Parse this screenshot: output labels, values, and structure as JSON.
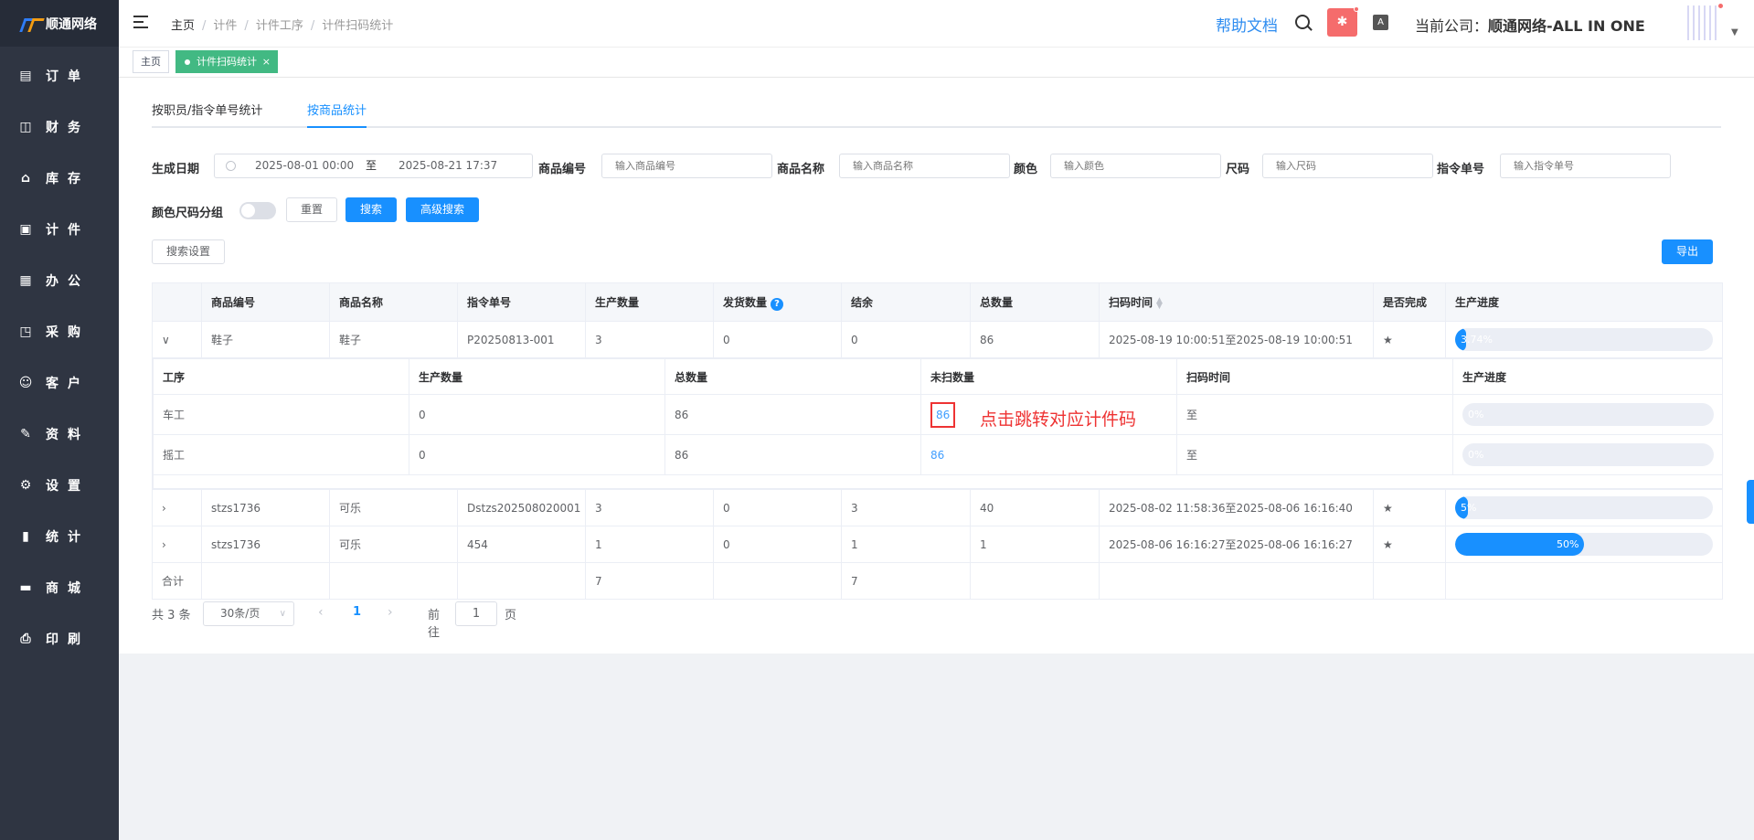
{
  "brand": {
    "name": "顺通网络"
  },
  "sidebar": {
    "items": [
      {
        "label": "订单",
        "icon": "order-icon",
        "glyph": "▤"
      },
      {
        "label": "财务",
        "icon": "finance-icon",
        "glyph": "◫"
      },
      {
        "label": "库存",
        "icon": "warehouse-icon",
        "glyph": "⌂"
      },
      {
        "label": "计件",
        "icon": "clipboard-icon",
        "glyph": "▣"
      },
      {
        "label": "办公",
        "icon": "calendar-icon",
        "glyph": "▦"
      },
      {
        "label": "采购",
        "icon": "bag-icon",
        "glyph": "◳"
      },
      {
        "label": "客户",
        "icon": "user-icon",
        "glyph": "☺"
      },
      {
        "label": "资料",
        "icon": "edit-icon",
        "glyph": "✎"
      },
      {
        "label": "设置",
        "icon": "gear-icon",
        "glyph": "⚙"
      },
      {
        "label": "统计",
        "icon": "bar-chart-icon",
        "glyph": "▮"
      },
      {
        "label": "商城",
        "icon": "shop-icon",
        "glyph": "▬"
      },
      {
        "label": "印刷",
        "icon": "printer-icon",
        "glyph": "⎙"
      }
    ]
  },
  "header": {
    "breadcrumb": [
      "主页",
      "计件",
      "计件工序",
      "计件扫码统计"
    ],
    "help": "帮助文档",
    "company_label": "当前公司：",
    "company_name": "顺通网络-ALL IN ONE",
    "translate_glyph": "A",
    "bug_glyph": "✱"
  },
  "tags": {
    "home": "主页",
    "active": "计件扫码统计",
    "close": "×"
  },
  "tabs": [
    "按职员/指令单号统计",
    "按商品统计"
  ],
  "filters": {
    "date_label": "生成日期",
    "date_start": "2025-08-01 00:00",
    "date_to": "至",
    "date_end": "2025-08-21 17:37",
    "product_code_label": "商品编号",
    "product_code_placeholder": "输入商品编号",
    "product_name_label": "商品名称",
    "product_name_placeholder": "输入商品名称",
    "color_label": "颜色",
    "color_placeholder": "输入颜色",
    "size_label": "尺码",
    "size_placeholder": "输入尺码",
    "order_label": "指令单号",
    "order_placeholder": "输入指令单号",
    "group_label": "颜色尺码分组",
    "group_on": false,
    "reset": "重置",
    "search": "搜索",
    "advanced": "高级搜索",
    "search_settings": "搜索设置",
    "export": "导出"
  },
  "table": {
    "headers": [
      "商品编号",
      "商品名称",
      "指令单号",
      "生产数量",
      "发货数量",
      "结余",
      "总数量",
      "扫码时间",
      "是否完成",
      "生产进度"
    ],
    "help_glyph": "?",
    "rows": [
      {
        "expanded": true,
        "code": "鞋子",
        "name": "鞋子",
        "order": "P20250813-001",
        "produced": "3",
        "shipped": "0",
        "balance": "0",
        "total": "86",
        "scan_time": "2025-08-19 10:00:51至2025-08-19 10:00:51",
        "done": true,
        "progress": 3.74,
        "progress_label": "3.74%"
      },
      {
        "expanded": false,
        "code": "stzs1736",
        "name": "可乐",
        "order": "Dstzs202508020001",
        "produced": "3",
        "shipped": "0",
        "balance": "3",
        "total": "40",
        "scan_time": "2025-08-02 11:58:36至2025-08-06 16:16:40",
        "done": true,
        "progress": 5,
        "progress_label": "5%"
      },
      {
        "expanded": false,
        "code": "stzs1736",
        "name": "可乐",
        "order": "454",
        "produced": "1",
        "shipped": "0",
        "balance": "1",
        "total": "1",
        "scan_time": "2025-08-06 16:16:27至2025-08-06 16:16:27",
        "done": true,
        "progress": 50,
        "progress_label": "50%"
      }
    ],
    "sub": {
      "headers": [
        "工序",
        "生产数量",
        "总数量",
        "未扫数量",
        "扫码时间",
        "生产进度"
      ],
      "rows": [
        {
          "process": "车工",
          "produced": "0",
          "total": "86",
          "unscanned": "86",
          "scan_time": "至",
          "progress": 0,
          "progress_label": "0%"
        },
        {
          "process": "摇工",
          "produced": "0",
          "total": "86",
          "unscanned": "86",
          "scan_time": "至",
          "progress": 0,
          "progress_label": "0%"
        }
      ]
    },
    "summary": {
      "label": "合计",
      "produced": "7",
      "balance": "7"
    }
  },
  "annotation": "点击跳转对应计件码",
  "pager": {
    "total": "共 3 条",
    "page_size": "30条/页",
    "current": "1",
    "goto": "前往",
    "goto_value": "1",
    "unit": "页"
  },
  "colors": {
    "primary": "#1890ff",
    "sidebar": "#2f3542",
    "success": "#52c41a",
    "tag_active": "#42b983",
    "annotation": "#ee3333"
  }
}
